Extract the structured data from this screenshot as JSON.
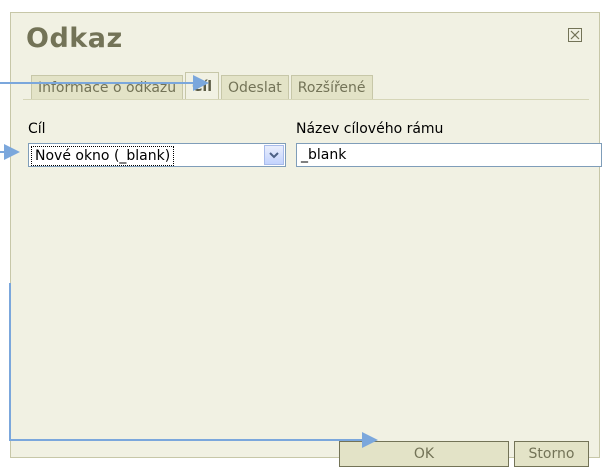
{
  "dialog": {
    "title": "Odkaz",
    "close_icon": "close-icon"
  },
  "tabs": [
    {
      "label": "Informace o odkazu",
      "active": false
    },
    {
      "label": "Cíl",
      "active": true
    },
    {
      "label": "Odeslat",
      "active": false
    },
    {
      "label": "Rozšířené",
      "active": false
    }
  ],
  "target": {
    "label": "Cíl",
    "selected_value": "Nové okno (_blank)"
  },
  "frame_name": {
    "label": "Název cílového rámu",
    "value": "_blank"
  },
  "buttons": {
    "ok_label": "OK",
    "cancel_label": "Storno"
  },
  "colors": {
    "dialog_bg": "#f1f1e3",
    "accent_text": "#737357",
    "annotation_arrow": "#7ba7dc"
  }
}
